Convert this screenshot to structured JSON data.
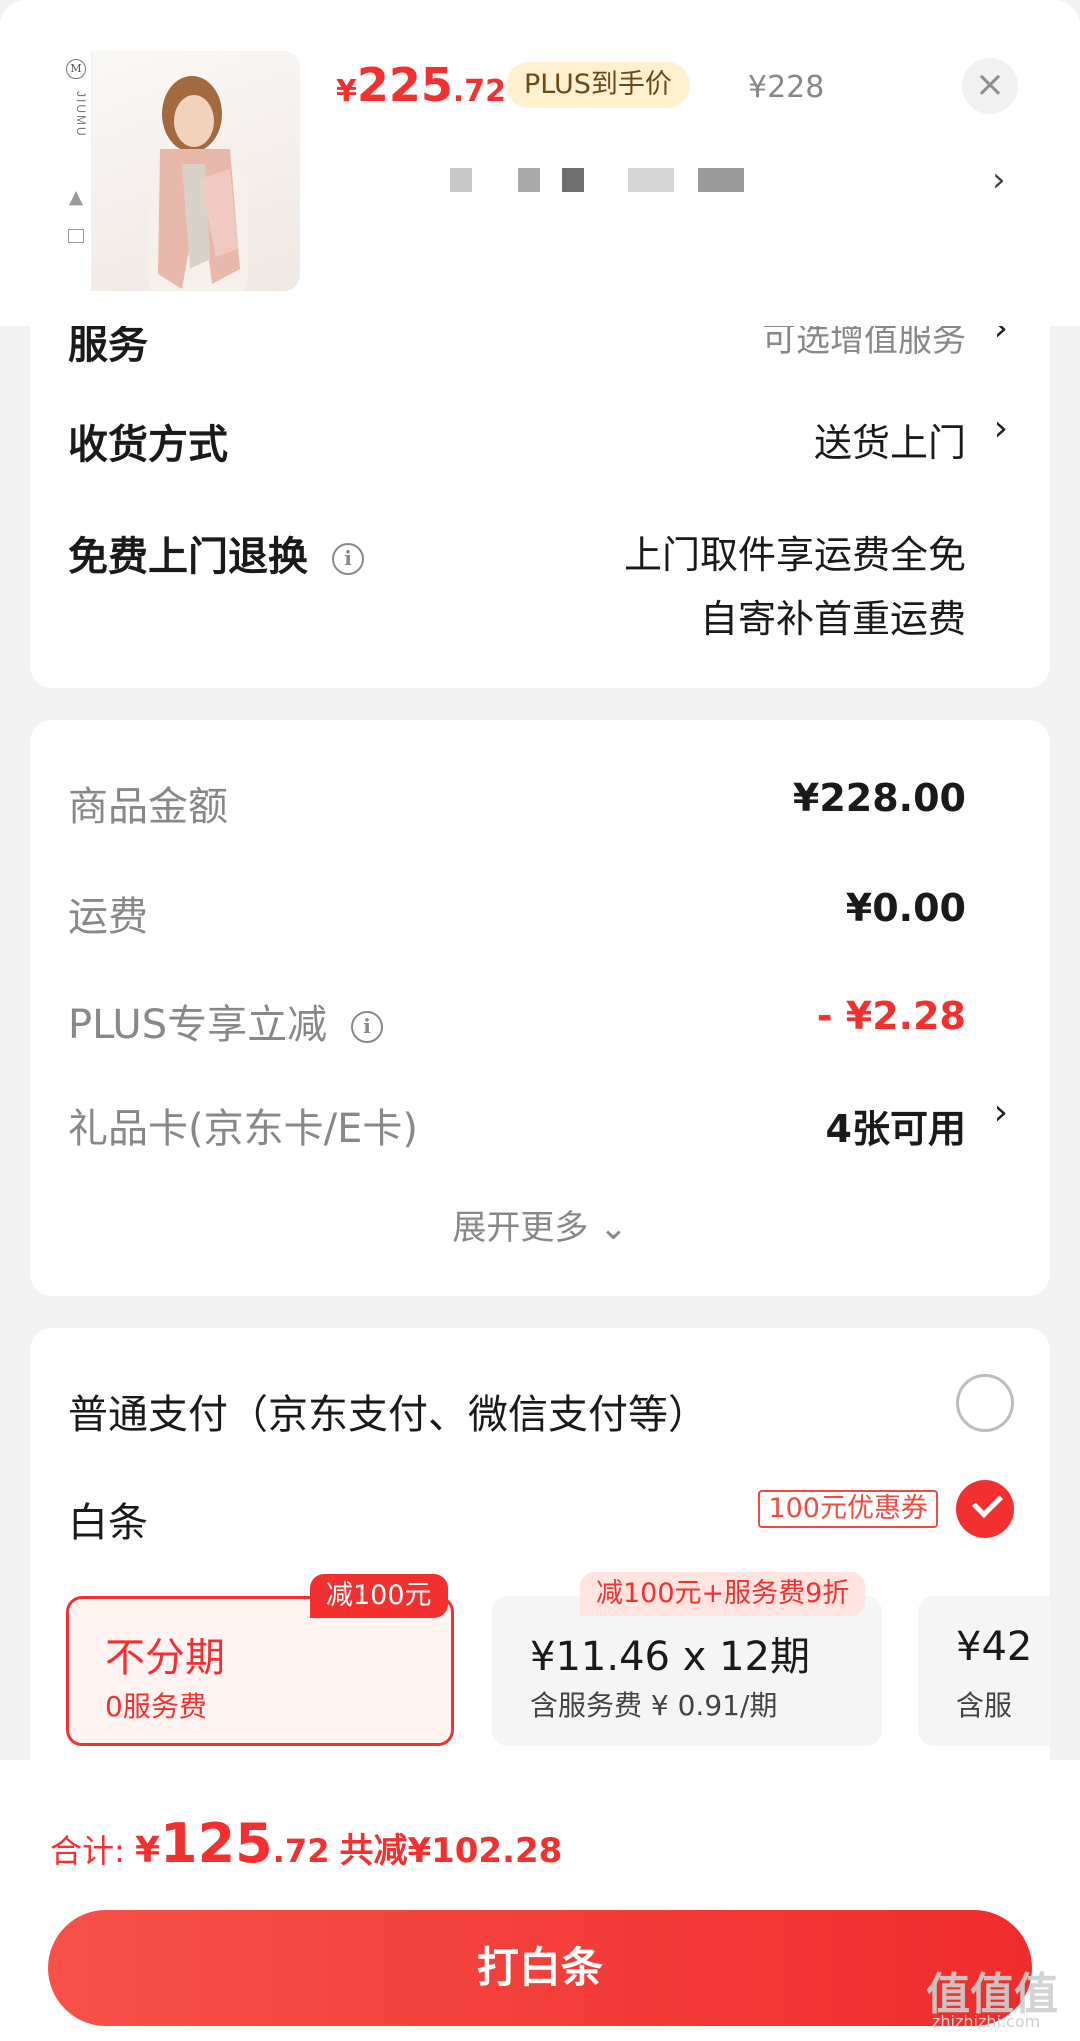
{
  "product": {
    "price_symbol": "¥",
    "price_int": "225",
    "price_dec": ".72",
    "plus_badge": "PLUS到手价",
    "original_price": "¥228",
    "brand_text": "JIUMU",
    "thumb_text": "M"
  },
  "icons": {
    "close": "close-icon",
    "chevron": "›",
    "info": "i"
  },
  "delivery": {
    "service_label": "服务",
    "service_value": "可选增值服务",
    "shipping_label": "收货方式",
    "shipping_value": "送货上门",
    "return_label": "免费上门退换",
    "return_value_1": "上门取件享运费全免",
    "return_value_2": "自寄补首重运费"
  },
  "summary": {
    "goods_label": "商品金额",
    "goods_value": "¥228.00",
    "freight_label": "运费",
    "freight_value": "¥0.00",
    "plus_label": "PLUS专享立减",
    "plus_value": "- ¥2.28",
    "giftcard_label": "礼品卡(京东卡/E卡)",
    "giftcard_value": "4张可用",
    "expand_label": "展开更多 ⌄"
  },
  "payment": {
    "normal_label": "普通支付（京东支付、微信支付等）",
    "baitiao_label": "白条",
    "coupon": "100元优惠券",
    "plans": [
      {
        "tag": "减100元",
        "title": "不分期",
        "sub": "0服务费"
      },
      {
        "tag": "减100元+服务费9折",
        "title": "¥11.46 x 12期",
        "sub": "含服务费 ¥ 0.91/期"
      },
      {
        "title": "¥42",
        "sub": "含服"
      }
    ]
  },
  "footer": {
    "total_label": "合计: ",
    "total_symbol": "¥",
    "total_int": "125",
    "total_dec": ".72",
    "total_saved": "共减¥102.28",
    "pay_button": "打白条"
  },
  "watermark": {
    "text": "值值值",
    "url": "zhizhizhi.com"
  },
  "colors": {
    "accent": "#f23030",
    "plus_badge_bg": "#fff1cf",
    "background": "#f2f2f2"
  }
}
